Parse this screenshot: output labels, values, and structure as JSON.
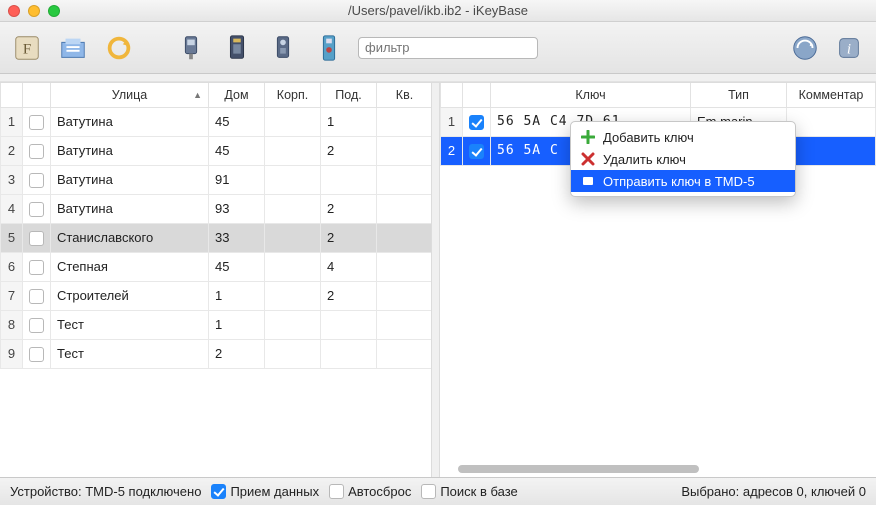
{
  "window": {
    "title": "/Users/pavel/ikb.ib2 - iKeyBase"
  },
  "toolbar": {
    "filter_placeholder": "фильтр"
  },
  "left_table": {
    "headers": {
      "street": "Улица",
      "house": "Дом",
      "korp": "Корп.",
      "pod": "Под.",
      "kv": "Кв."
    },
    "rows": [
      {
        "n": "1",
        "street": "Ватутина",
        "house": "45",
        "korp": "",
        "pod": "1",
        "kv": ""
      },
      {
        "n": "2",
        "street": "Ватутина",
        "house": "45",
        "korp": "",
        "pod": "2",
        "kv": ""
      },
      {
        "n": "3",
        "street": "Ватутина",
        "house": "91",
        "korp": "",
        "pod": "",
        "kv": ""
      },
      {
        "n": "4",
        "street": "Ватутина",
        "house": "93",
        "korp": "",
        "pod": "2",
        "kv": ""
      },
      {
        "n": "5",
        "street": "Станиславского",
        "house": "33",
        "korp": "",
        "pod": "2",
        "kv": "",
        "selected": true
      },
      {
        "n": "6",
        "street": "Степная",
        "house": "45",
        "korp": "",
        "pod": "4",
        "kv": ""
      },
      {
        "n": "7",
        "street": "Строителей",
        "house": "1",
        "korp": "",
        "pod": "2",
        "kv": ""
      },
      {
        "n": "8",
        "street": "Тест",
        "house": "1",
        "korp": "",
        "pod": "",
        "kv": ""
      },
      {
        "n": "9",
        "street": "Тест",
        "house": "2",
        "korp": "",
        "pod": "",
        "kv": ""
      }
    ]
  },
  "right_table": {
    "headers": {
      "key": "Ключ",
      "type": "Тип",
      "comment": "Комментар"
    },
    "rows": [
      {
        "n": "1",
        "checked": true,
        "key": "56 5A C4 7D 61",
        "type": "Em marin"
      },
      {
        "n": "2",
        "checked": true,
        "key": "56 5A C",
        "type": "",
        "highlight": true
      }
    ]
  },
  "context_menu": {
    "add": "Добавить ключ",
    "del": "Удалить ключ",
    "send": "Отправить ключ в TMD-5"
  },
  "status": {
    "device": "Устройство: TMD-5 подключено",
    "recv": "Прием данных",
    "autoreset": "Автосброс",
    "search": "Поиск в базе",
    "selected": "Выбрано: адресов 0, ключей 0"
  }
}
